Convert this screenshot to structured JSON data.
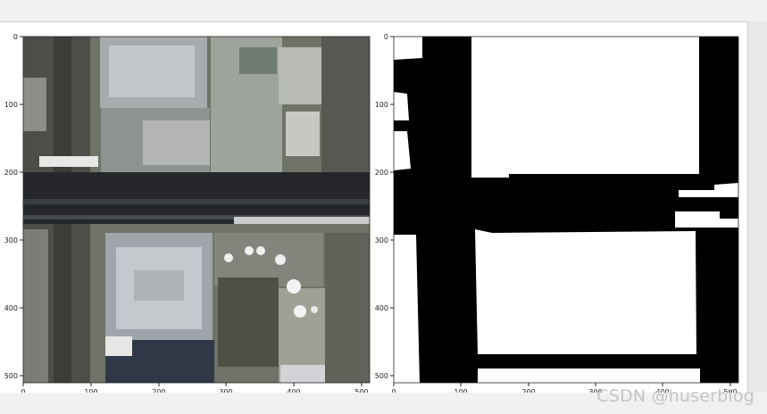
{
  "figure": {
    "left_plot": {
      "kind": "aerial-image",
      "x_ticks": [
        "0",
        "100",
        "200",
        "300",
        "400",
        "500"
      ],
      "y_ticks": [
        "0",
        "100",
        "200",
        "300",
        "400",
        "500"
      ]
    },
    "right_plot": {
      "kind": "binary-mask",
      "x_ticks": [
        "0",
        "100",
        "200",
        "300",
        "400",
        "500"
      ],
      "y_ticks": [
        "0",
        "100",
        "200",
        "300",
        "400",
        "500"
      ]
    },
    "extent": [
      0,
      512
    ],
    "colors": {
      "mask_background": "#000000",
      "mask_foreground": "#ffffff",
      "axis": "#222222"
    }
  },
  "watermark": {
    "text": "CSDN @huserblog"
  }
}
